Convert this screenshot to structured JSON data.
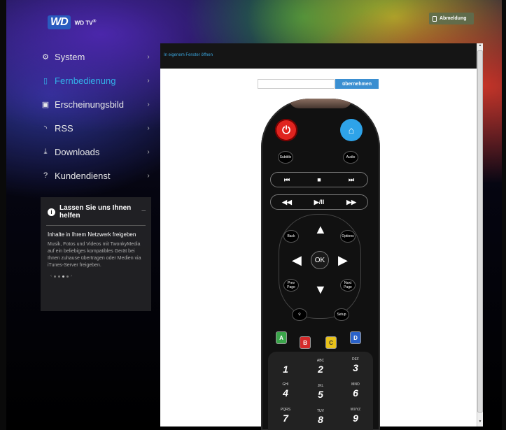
{
  "header": {
    "logo_wd": "WD",
    "logo_product": "WD TV",
    "logo_reg": "®",
    "logout_label": "Abmeldung"
  },
  "nav": {
    "items": [
      {
        "label": "System",
        "icon": "gear-icon",
        "active": false
      },
      {
        "label": "Fernbedienung",
        "icon": "remote-icon",
        "active": true
      },
      {
        "label": "Erscheinungsbild",
        "icon": "image-icon",
        "active": false
      },
      {
        "label": "RSS",
        "icon": "rss-icon",
        "active": false
      },
      {
        "label": "Downloads",
        "icon": "download-icon",
        "active": false
      },
      {
        "label": "Kundendienst",
        "icon": "question-icon",
        "active": false
      }
    ]
  },
  "help": {
    "title": "Lassen Sie uns Ihnen helfen",
    "close": "_",
    "subtitle": "Inhalte in Ihrem Netzwerk freigeben",
    "body": "Musik, Fotos und Videos mit TwonkyMedia auf ein beliebiges kompatibles Gerät bei Ihnen zuhause übertragen oder Medien via iTunes-Server freigeben."
  },
  "content": {
    "popout_link": "In eigenem Fenster öffnen",
    "url_value": "",
    "apply_label": "übernehmen"
  },
  "remote": {
    "subtitle": "Subtitle",
    "audio": "Audio",
    "transport1": [
      "⏮",
      "■",
      "⏭"
    ],
    "transport2": [
      "◀◀",
      "▶/II",
      "▶▶"
    ],
    "back": "Back",
    "options": "Options",
    "ok": "OK",
    "prev_page": "Prev Page",
    "next_page": "Next Page",
    "setup": "Setup",
    "colors": [
      {
        "label": "A",
        "color": "#3aa54a"
      },
      {
        "label": "B",
        "color": "#d42a2a"
      },
      {
        "label": "C",
        "color": "#e8c21a"
      },
      {
        "label": "D",
        "color": "#2a62c9"
      }
    ],
    "keys": [
      {
        "letters": "",
        "num": "1"
      },
      {
        "letters": "ABC",
        "num": "2"
      },
      {
        "letters": "DEF",
        "num": "3"
      },
      {
        "letters": "GHI",
        "num": "4"
      },
      {
        "letters": "JKL",
        "num": "5"
      },
      {
        "letters": "MNO",
        "num": "6"
      },
      {
        "letters": "PQRS",
        "num": "7"
      },
      {
        "letters": "TUV",
        "num": "8"
      },
      {
        "letters": "WXYZ",
        "num": "9"
      }
    ]
  }
}
